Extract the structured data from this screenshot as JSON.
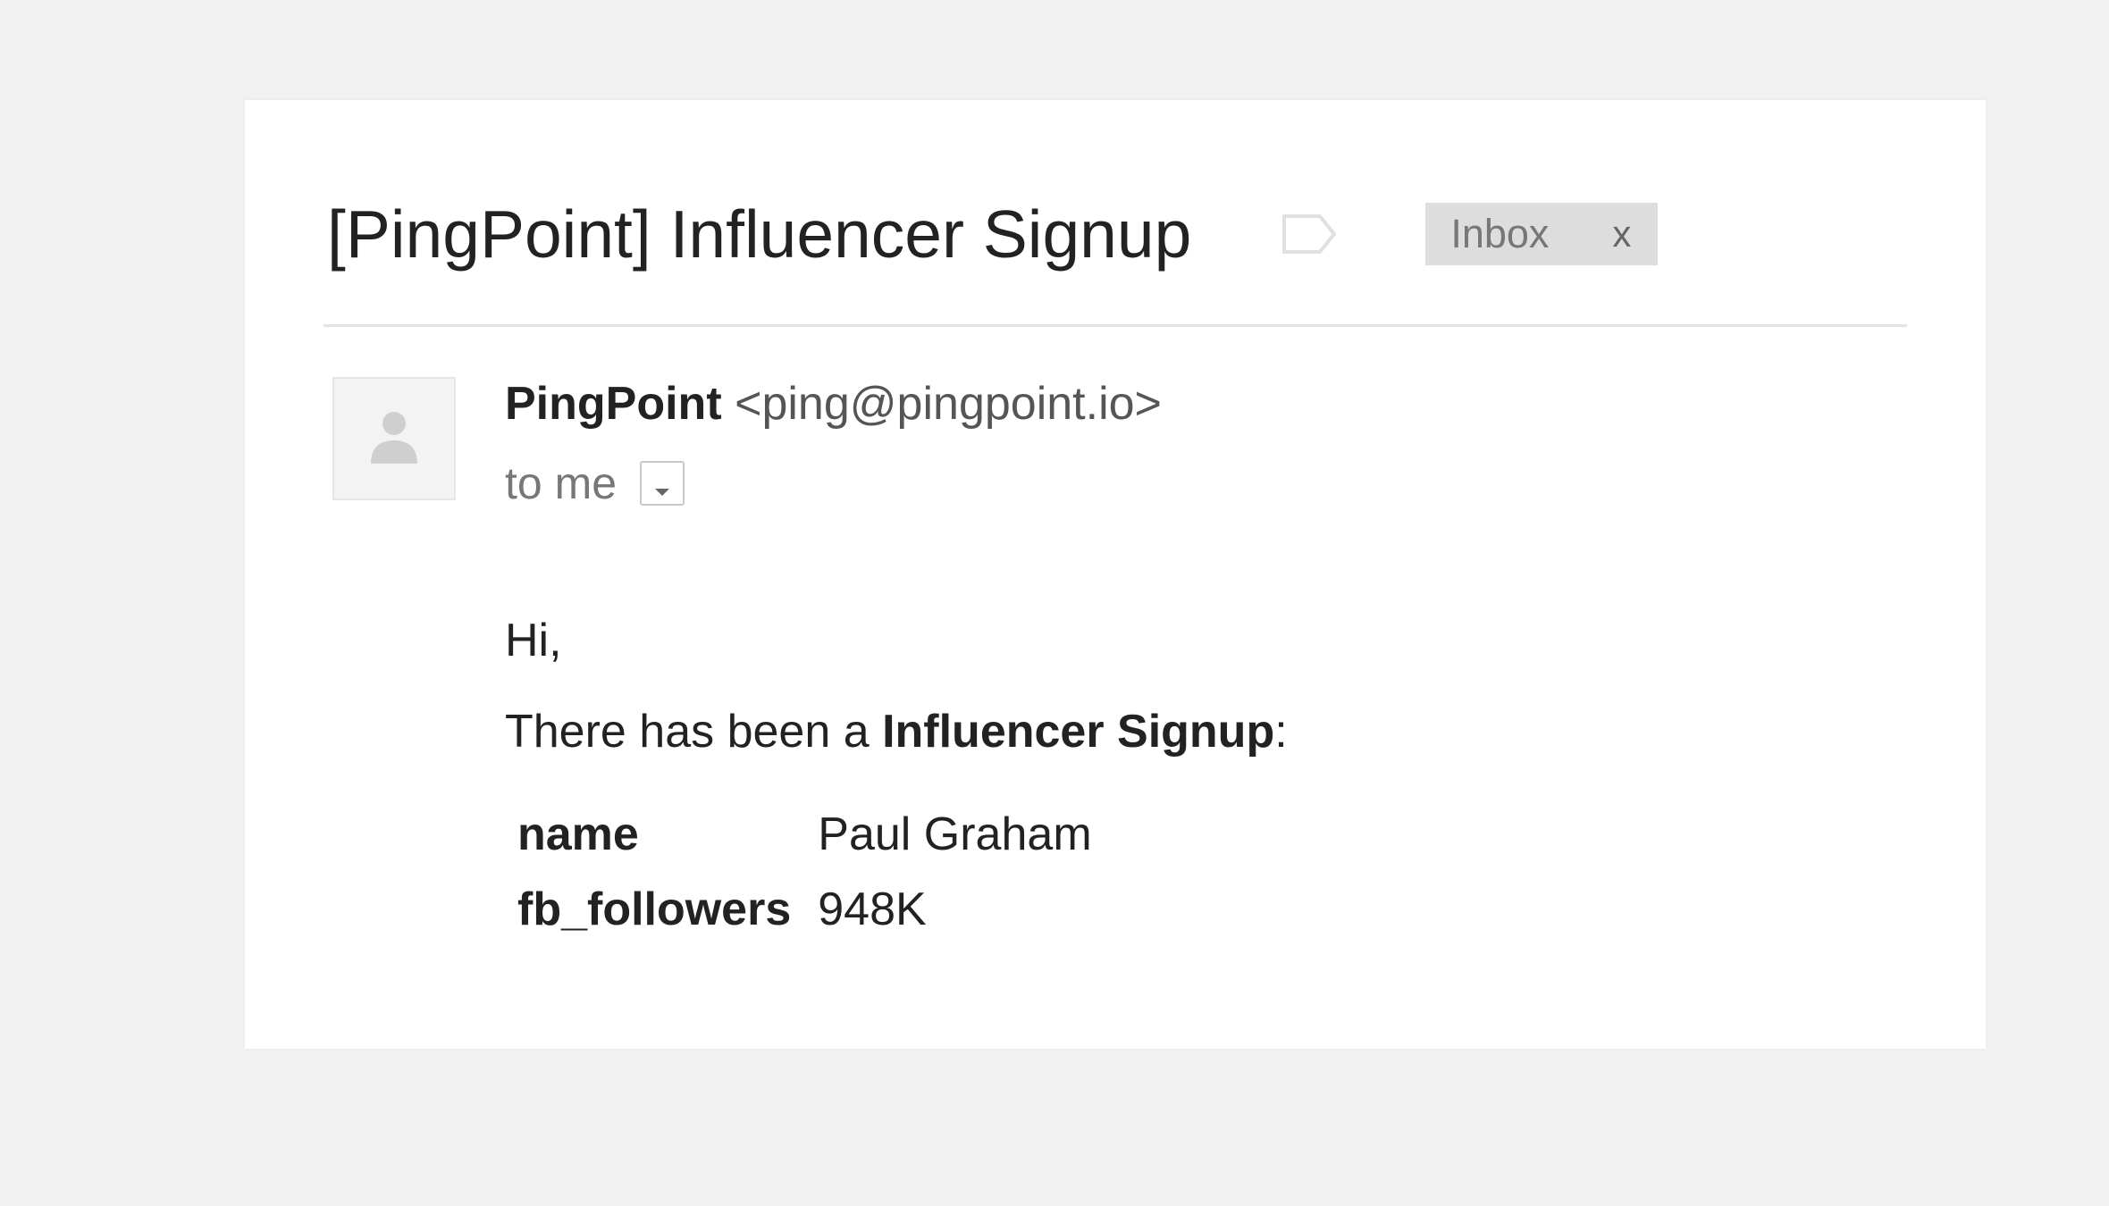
{
  "email": {
    "subject": "[PingPoint] Influencer Signup",
    "label_icon": "label-tag-icon",
    "chip": {
      "label": "Inbox",
      "remove": "x"
    },
    "sender": {
      "name": "PingPoint",
      "email": "<ping@pingpoint.io>",
      "avatar_icon": "person-icon"
    },
    "recipients": "to me",
    "body": {
      "greeting": "Hi,",
      "intro_prefix": "There has been a ",
      "intro_bold": "Influencer Signup",
      "intro_suffix": ":",
      "fields": [
        {
          "key": "name",
          "value": "Paul Graham"
        },
        {
          "key": "fb_followers",
          "value": "948K"
        }
      ]
    }
  },
  "colors": {
    "page_background": "#f1f1f2",
    "card_background": "#ffffff",
    "chip_background": "#dddddd",
    "text_primary": "#222222",
    "text_secondary": "#777777"
  }
}
